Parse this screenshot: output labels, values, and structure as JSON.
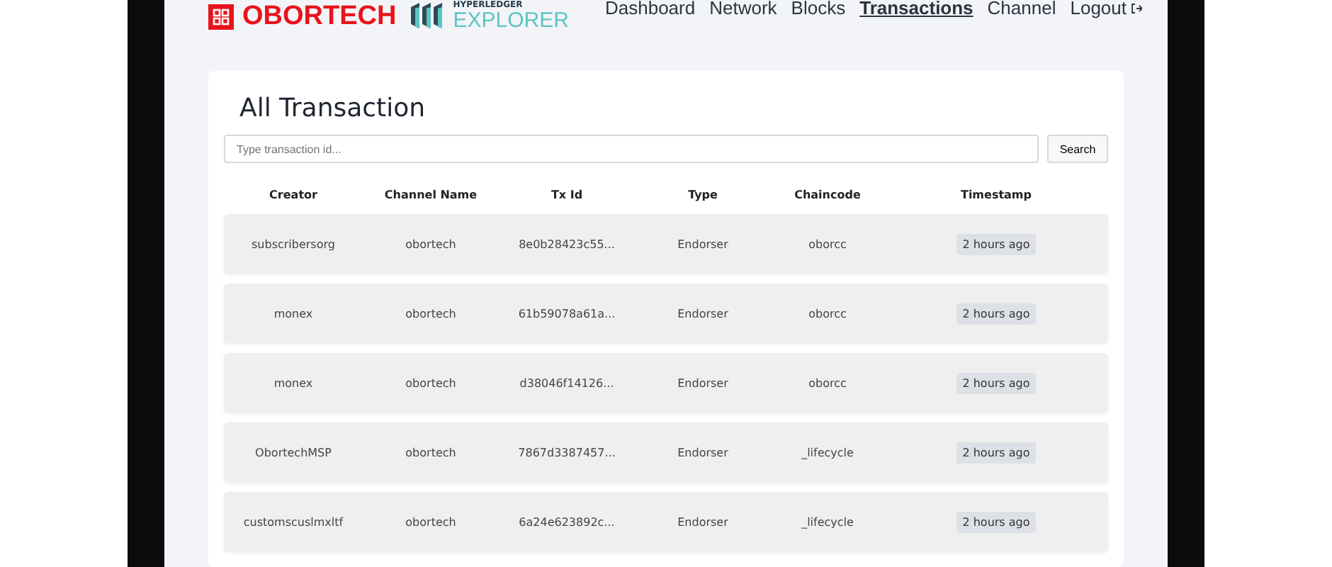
{
  "header": {
    "brand": "OBORTECH",
    "explorer_top": "HYPERLEDGER",
    "explorer": "EXPLORER",
    "nav": [
      {
        "label": "Dashboard",
        "selected": false
      },
      {
        "label": "Network",
        "selected": false
      },
      {
        "label": "Blocks",
        "selected": false
      },
      {
        "label": "Transactions",
        "selected": true
      },
      {
        "label": "Channel",
        "selected": false
      }
    ],
    "logout": "Logout"
  },
  "title": "All Transaction",
  "search": {
    "placeholder": "Type transaction id...",
    "button": "Search"
  },
  "table": {
    "columns": [
      "Creator",
      "Channel Name",
      "Tx Id",
      "Type",
      "Chaincode",
      "Timestamp"
    ],
    "rows": [
      [
        "subscribersorg",
        "obortech",
        "8e0b28423c55...",
        "Endorser",
        "oborcc",
        "2 hours ago"
      ],
      [
        "monex",
        "obortech",
        "61b59078a61a...",
        "Endorser",
        "oborcc",
        "2 hours ago"
      ],
      [
        "monex",
        "obortech",
        "d38046f14126...",
        "Endorser",
        "oborcc",
        "2 hours ago"
      ],
      [
        "ObortechMSP",
        "obortech",
        "7867d3387457...",
        "Endorser",
        "_lifecycle",
        "2 hours ago"
      ],
      [
        "customscuslmxltf",
        "obortech",
        "6a24e623892c...",
        "Endorser",
        "_lifecycle",
        "2 hours ago"
      ]
    ]
  }
}
